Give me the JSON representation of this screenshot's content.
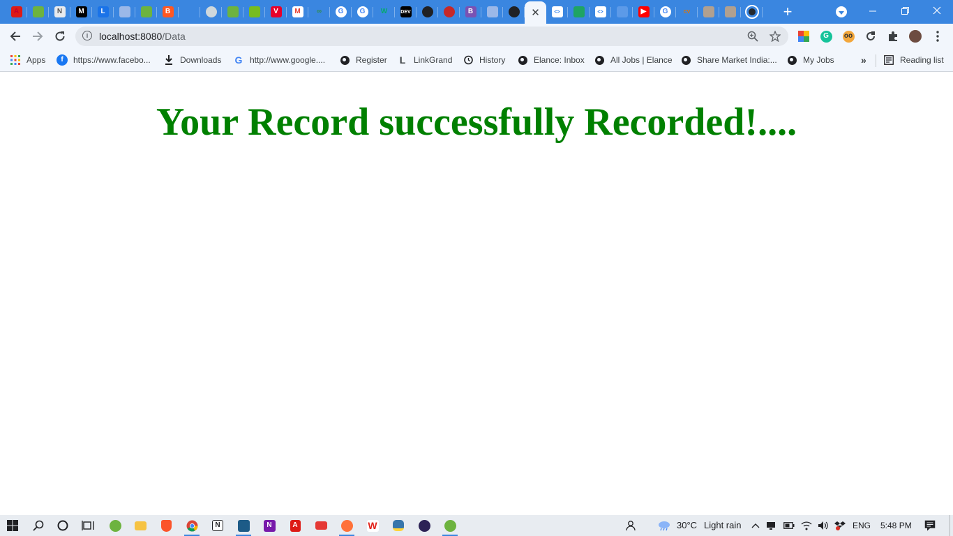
{
  "tabs": [
    {
      "icon": "angular-icon",
      "glyph": "A",
      "color": "#c3002f",
      "bg": "#dd1b16"
    },
    {
      "icon": "spring-leaf-icon",
      "glyph": "",
      "color": "#6db33f",
      "bg": "#6db33f"
    },
    {
      "icon": "nextjs-icon",
      "glyph": "N",
      "color": "#555",
      "bg": "#e8eaed"
    },
    {
      "icon": "medium-icon",
      "glyph": "M",
      "color": "#fff",
      "bg": "#000000"
    },
    {
      "icon": "linkgrand-icon",
      "glyph": "L",
      "color": "#fff",
      "bg": "#1a73e8"
    },
    {
      "icon": "page-icon",
      "glyph": "",
      "color": "#fff",
      "bg": "#9bb8e8"
    },
    {
      "icon": "spring-leaf-icon",
      "glyph": "",
      "color": "#fff",
      "bg": "#6db33f"
    },
    {
      "icon": "blogger-icon",
      "glyph": "B",
      "color": "#fff",
      "bg": "#ff5722"
    },
    {
      "icon": "blank-page-icon",
      "glyph": "",
      "color": "#fff",
      "bg": "#3a86e0"
    },
    {
      "icon": "avatar-icon",
      "glyph": "",
      "color": "#fff",
      "bg": "#cfd8dc"
    },
    {
      "icon": "spring-leaf-icon",
      "glyph": "",
      "color": "#fff",
      "bg": "#6db33f"
    },
    {
      "icon": "spring-boot-icon",
      "glyph": "",
      "color": "#fff",
      "bg": "#77bc1f"
    },
    {
      "icon": "vaadin-icon",
      "glyph": "V",
      "color": "#fff",
      "bg": "#e8002a"
    },
    {
      "icon": "gmail-icon",
      "glyph": "M",
      "color": "#ea4335",
      "bg": "#ffffff"
    },
    {
      "icon": "geeksforgeeks-icon",
      "glyph": "∞",
      "color": "#2f8d46",
      "bg": "#3a86e0"
    },
    {
      "icon": "google-icon",
      "glyph": "G",
      "color": "#4285f4",
      "bg": "#ffffff"
    },
    {
      "icon": "google-icon",
      "glyph": "G",
      "color": "#4285f4",
      "bg": "#ffffff"
    },
    {
      "icon": "w3schools-icon",
      "glyph": "W",
      "color": "#04aa6d",
      "bg": "#3a86e0"
    },
    {
      "icon": "dev-icon",
      "glyph": "DEV",
      "color": "#fff",
      "bg": "#000000"
    },
    {
      "icon": "globe-icon",
      "glyph": "",
      "color": "#fff",
      "bg": "#202124"
    },
    {
      "icon": "record-icon",
      "glyph": "",
      "color": "#fff",
      "bg": "#c62828"
    },
    {
      "icon": "bootstrap-icon",
      "glyph": "B",
      "color": "#fff",
      "bg": "#7952b3"
    },
    {
      "icon": "page-icon",
      "glyph": "",
      "color": "#fff",
      "bg": "#9bb8e8"
    },
    {
      "icon": "globe-icon",
      "glyph": "",
      "color": "#fff",
      "bg": "#202124"
    },
    {
      "icon": "close-icon",
      "glyph": "✕",
      "color": "#3c4043",
      "bg": "",
      "active": true
    },
    {
      "icon": "code-icon",
      "glyph": "<>",
      "color": "#1a73e8",
      "bg": "#ffffff"
    },
    {
      "icon": "bookmark-icon",
      "glyph": "",
      "color": "#fff",
      "bg": "#1fa463"
    },
    {
      "icon": "code-icon",
      "glyph": "<>",
      "color": "#1a73e8",
      "bg": "#ffffff"
    },
    {
      "icon": "blank-page-icon",
      "glyph": "",
      "color": "#fff",
      "bg": "#5c9ae8"
    },
    {
      "icon": "youtube-icon",
      "glyph": "▶",
      "color": "#fff",
      "bg": "#ff0000"
    },
    {
      "icon": "google-icon",
      "glyph": "G",
      "color": "#4285f4",
      "bg": "#ffffff"
    },
    {
      "icon": "cv-icon",
      "glyph": "CV",
      "color": "#e37400",
      "bg": "#3a86e0"
    },
    {
      "icon": "page-icon",
      "glyph": "",
      "color": "#fff",
      "bg": "#b0a090"
    },
    {
      "icon": "page-icon",
      "glyph": "",
      "color": "#fff",
      "bg": "#b0a090"
    },
    {
      "icon": "github-icon",
      "glyph": "",
      "color": "#fff",
      "bg": "#3a86e0"
    }
  ],
  "address_bar": {
    "host": "localhost:8080",
    "path": "/Data"
  },
  "bookmarks": [
    {
      "label": "Apps",
      "icon": "apps-grid-icon"
    },
    {
      "label": "https://www.facebo...",
      "icon": "facebook-icon"
    },
    {
      "label": "Downloads",
      "icon": "download-icon"
    },
    {
      "label": "http://www.google....",
      "icon": "google-icon"
    },
    {
      "label": "Register",
      "icon": "globe-icon"
    },
    {
      "label": "LinkGrand",
      "icon": "linkgrand-icon"
    },
    {
      "label": "History",
      "icon": "history-icon"
    },
    {
      "label": "Elance: Inbox",
      "icon": "globe-icon"
    },
    {
      "label": "All Jobs | Elance",
      "icon": "globe-icon"
    },
    {
      "label": "Share Market India:...",
      "icon": "globe-icon"
    },
    {
      "label": "My Jobs",
      "icon": "globe-icon"
    }
  ],
  "bookmarks_more": "»",
  "reading_list": "Reading list",
  "page": {
    "message": "Your Record successfully Recorded!...."
  },
  "colors": {
    "message": "#008000",
    "tabstrip": "#3a86e0"
  },
  "taskbar": {
    "weather_temp": "30°C",
    "weather_desc": "Light rain",
    "language": "ENG",
    "time": "5:48 PM"
  }
}
